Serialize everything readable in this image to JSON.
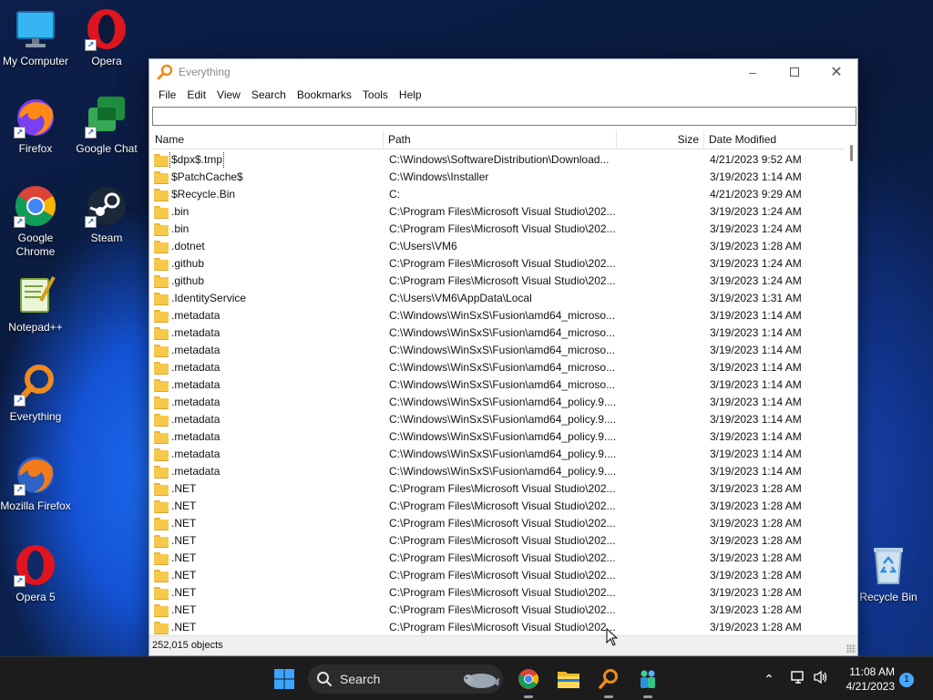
{
  "desktop": {
    "icons": [
      {
        "label": "My Computer"
      },
      {
        "label": "Opera"
      },
      {
        "label": "Firefox"
      },
      {
        "label": "Google Chat"
      },
      {
        "label": "Google Chrome"
      },
      {
        "label": "Steam"
      },
      {
        "label": "Notepad++"
      },
      {
        "label": "Everything"
      },
      {
        "label": "Mozilla Firefox"
      },
      {
        "label": "Opera 5"
      },
      {
        "label": "Recycle Bin"
      }
    ]
  },
  "window": {
    "title": "Everything",
    "menu": [
      "File",
      "Edit",
      "View",
      "Search",
      "Bookmarks",
      "Tools",
      "Help"
    ],
    "search": {
      "value": "",
      "placeholder": ""
    },
    "columns": {
      "name": "Name",
      "path": "Path",
      "size": "Size",
      "date": "Date Modified"
    },
    "rows": [
      {
        "name": "$dpx$.tmp",
        "path": "C:\\Windows\\SoftwareDistribution\\Download...",
        "size": "",
        "date": "4/21/2023 9:52 AM"
      },
      {
        "name": "$PatchCache$",
        "path": "C:\\Windows\\Installer",
        "size": "",
        "date": "3/19/2023 1:14 AM"
      },
      {
        "name": "$Recycle.Bin",
        "path": "C:",
        "size": "",
        "date": "4/21/2023 9:29 AM"
      },
      {
        "name": ".bin",
        "path": "C:\\Program Files\\Microsoft Visual Studio\\202...",
        "size": "",
        "date": "3/19/2023 1:24 AM"
      },
      {
        "name": ".bin",
        "path": "C:\\Program Files\\Microsoft Visual Studio\\202...",
        "size": "",
        "date": "3/19/2023 1:24 AM"
      },
      {
        "name": ".dotnet",
        "path": "C:\\Users\\VM6",
        "size": "",
        "date": "3/19/2023 1:28 AM"
      },
      {
        "name": ".github",
        "path": "C:\\Program Files\\Microsoft Visual Studio\\202...",
        "size": "",
        "date": "3/19/2023 1:24 AM"
      },
      {
        "name": ".github",
        "path": "C:\\Program Files\\Microsoft Visual Studio\\202...",
        "size": "",
        "date": "3/19/2023 1:24 AM"
      },
      {
        "name": ".IdentityService",
        "path": "C:\\Users\\VM6\\AppData\\Local",
        "size": "",
        "date": "3/19/2023 1:31 AM"
      },
      {
        "name": ".metadata",
        "path": "C:\\Windows\\WinSxS\\Fusion\\amd64_microso...",
        "size": "",
        "date": "3/19/2023 1:14 AM"
      },
      {
        "name": ".metadata",
        "path": "C:\\Windows\\WinSxS\\Fusion\\amd64_microso...",
        "size": "",
        "date": "3/19/2023 1:14 AM"
      },
      {
        "name": ".metadata",
        "path": "C:\\Windows\\WinSxS\\Fusion\\amd64_microso...",
        "size": "",
        "date": "3/19/2023 1:14 AM"
      },
      {
        "name": ".metadata",
        "path": "C:\\Windows\\WinSxS\\Fusion\\amd64_microso...",
        "size": "",
        "date": "3/19/2023 1:14 AM"
      },
      {
        "name": ".metadata",
        "path": "C:\\Windows\\WinSxS\\Fusion\\amd64_microso...",
        "size": "",
        "date": "3/19/2023 1:14 AM"
      },
      {
        "name": ".metadata",
        "path": "C:\\Windows\\WinSxS\\Fusion\\amd64_policy.9....",
        "size": "",
        "date": "3/19/2023 1:14 AM"
      },
      {
        "name": ".metadata",
        "path": "C:\\Windows\\WinSxS\\Fusion\\amd64_policy.9....",
        "size": "",
        "date": "3/19/2023 1:14 AM"
      },
      {
        "name": ".metadata",
        "path": "C:\\Windows\\WinSxS\\Fusion\\amd64_policy.9....",
        "size": "",
        "date": "3/19/2023 1:14 AM"
      },
      {
        "name": ".metadata",
        "path": "C:\\Windows\\WinSxS\\Fusion\\amd64_policy.9....",
        "size": "",
        "date": "3/19/2023 1:14 AM"
      },
      {
        "name": ".metadata",
        "path": "C:\\Windows\\WinSxS\\Fusion\\amd64_policy.9....",
        "size": "",
        "date": "3/19/2023 1:14 AM"
      },
      {
        "name": ".NET",
        "path": "C:\\Program Files\\Microsoft Visual Studio\\202...",
        "size": "",
        "date": "3/19/2023 1:28 AM"
      },
      {
        "name": ".NET",
        "path": "C:\\Program Files\\Microsoft Visual Studio\\202...",
        "size": "",
        "date": "3/19/2023 1:28 AM"
      },
      {
        "name": ".NET",
        "path": "C:\\Program Files\\Microsoft Visual Studio\\202...",
        "size": "",
        "date": "3/19/2023 1:28 AM"
      },
      {
        "name": ".NET",
        "path": "C:\\Program Files\\Microsoft Visual Studio\\202...",
        "size": "",
        "date": "3/19/2023 1:28 AM"
      },
      {
        "name": ".NET",
        "path": "C:\\Program Files\\Microsoft Visual Studio\\202...",
        "size": "",
        "date": "3/19/2023 1:28 AM"
      },
      {
        "name": ".NET",
        "path": "C:\\Program Files\\Microsoft Visual Studio\\202...",
        "size": "",
        "date": "3/19/2023 1:28 AM"
      },
      {
        "name": ".NET",
        "path": "C:\\Program Files\\Microsoft Visual Studio\\202...",
        "size": "",
        "date": "3/19/2023 1:28 AM"
      },
      {
        "name": ".NET",
        "path": "C:\\Program Files\\Microsoft Visual Studio\\202...",
        "size": "",
        "date": "3/19/2023 1:28 AM"
      },
      {
        "name": ".NET",
        "path": "C:\\Program Files\\Microsoft Visual Studio\\202...",
        "size": "",
        "date": "3/19/2023 1:28 AM"
      }
    ],
    "status": "252,015 objects"
  },
  "taskbar": {
    "search_label": "Search",
    "time": "11:08 AM",
    "date": "4/21/2023",
    "notification_count": "1"
  },
  "colors": {
    "accent": "#0067c0",
    "folder": "#f6c94d",
    "everything_orange": "#f08a1c"
  }
}
